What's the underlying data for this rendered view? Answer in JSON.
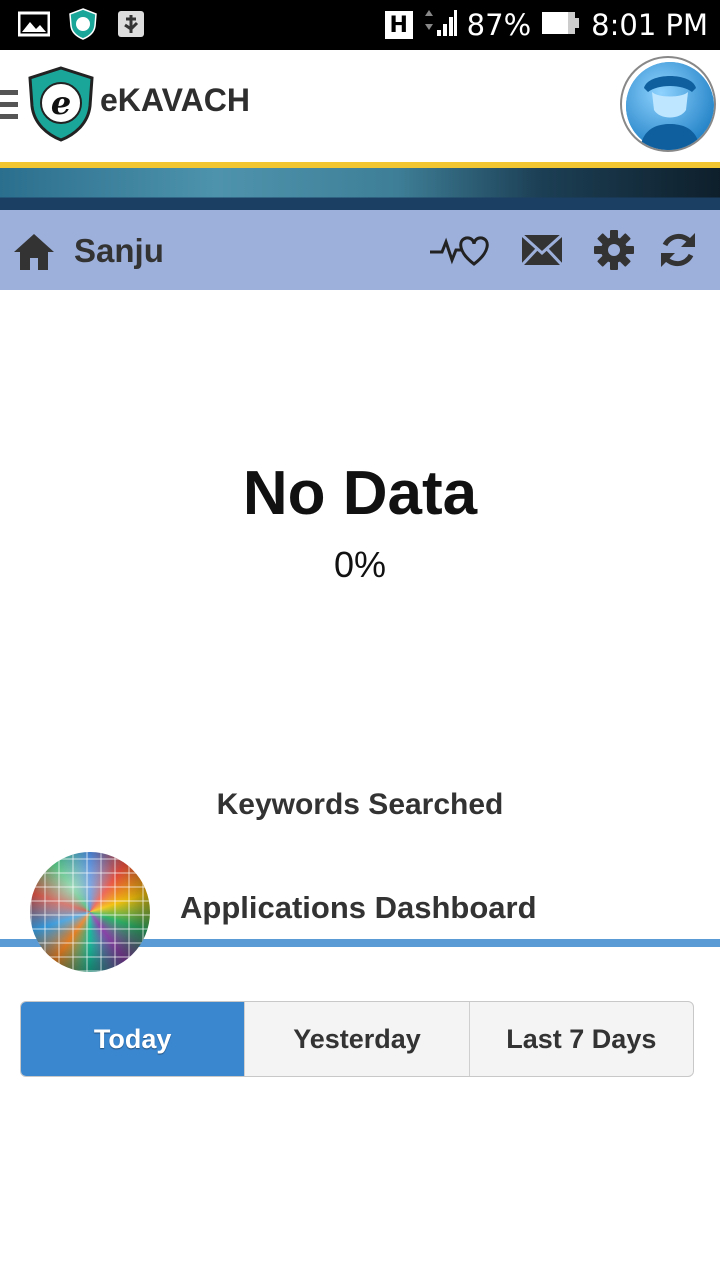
{
  "status_bar": {
    "network_type": "H",
    "battery": "87%",
    "time": "8:01 PM"
  },
  "app": {
    "title": "eKAVACH",
    "logo_letter": "e"
  },
  "nav": {
    "user_name": "Sanju",
    "icons": [
      "home-icon",
      "heartbeat-icon",
      "mail-icon",
      "settings-gear-icon",
      "refresh-icon"
    ]
  },
  "summary": {
    "title": "No Data",
    "percent": "0%"
  },
  "keywords": {
    "label": "Keywords Searched"
  },
  "applications": {
    "label": "Applications Dashboard"
  },
  "tabs": [
    {
      "label": "Today",
      "active": true
    },
    {
      "label": "Yesterday",
      "active": false
    },
    {
      "label": "Last 7 Days",
      "active": false
    }
  ],
  "colors": {
    "nav_bg": "#9db0db",
    "accent_blue": "#3a86cf",
    "divider_blue": "#5b9bd5",
    "header_yellow": "#f2c630",
    "shield_teal": "#1aa79a"
  }
}
